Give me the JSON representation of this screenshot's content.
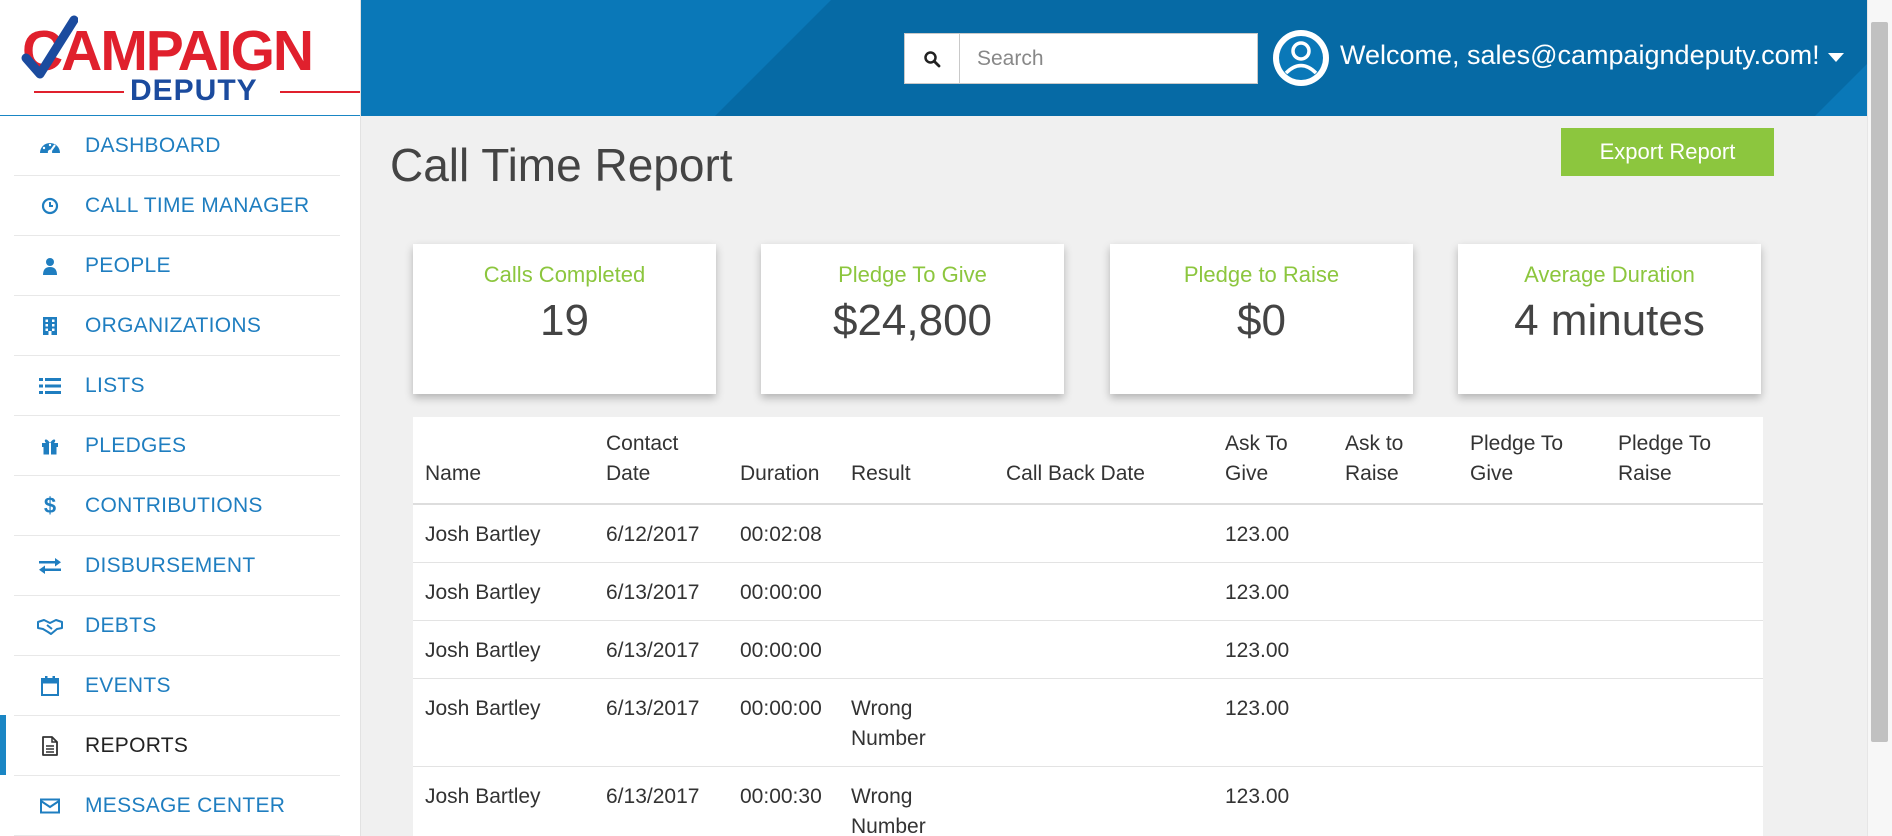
{
  "brand": {
    "logo_top": "CAMPAIGN",
    "logo_bottom": "DEPUTY",
    "colors": {
      "red": "#e0202d",
      "navy": "#1b4b9e",
      "header_blue": "#0a78b8",
      "link_blue": "#1f7ec0",
      "accent_green": "#8cc63e"
    }
  },
  "header": {
    "search_placeholder": "Search",
    "search_icon": "search-icon",
    "avatar_icon": "user-circle-icon",
    "welcome": "Welcome, sales@campaigndeputy.com!"
  },
  "sidebar": {
    "items": [
      {
        "label": "DASHBOARD",
        "icon": "dashboard-icon",
        "active": false
      },
      {
        "label": "CALL TIME MANAGER",
        "icon": "clock-icon",
        "active": false
      },
      {
        "label": "PEOPLE",
        "icon": "user-icon",
        "active": false
      },
      {
        "label": "ORGANIZATIONS",
        "icon": "building-icon",
        "active": false
      },
      {
        "label": "LISTS",
        "icon": "list-icon",
        "active": false
      },
      {
        "label": "PLEDGES",
        "icon": "gift-icon",
        "active": false
      },
      {
        "label": "CONTRIBUTIONS",
        "icon": "dollar-icon",
        "active": false
      },
      {
        "label": "DISBURSEMENT",
        "icon": "exchange-icon",
        "active": false
      },
      {
        "label": "DEBTS",
        "icon": "handshake-icon",
        "active": false
      },
      {
        "label": "EVENTS",
        "icon": "calendar-icon",
        "active": false
      },
      {
        "label": "REPORTS",
        "icon": "document-icon",
        "active": true
      },
      {
        "label": "MESSAGE CENTER",
        "icon": "envelope-icon",
        "active": false
      }
    ]
  },
  "main": {
    "title": "Call Time Report",
    "export_label": "Export Report",
    "stats": [
      {
        "label": "Calls Completed",
        "value": "19"
      },
      {
        "label": "Pledge To Give",
        "value": "$24,800"
      },
      {
        "label": "Pledge to Raise",
        "value": "$0"
      },
      {
        "label": "Average Duration",
        "value": "4 minutes"
      }
    ],
    "table": {
      "columns": [
        [
          "Name"
        ],
        [
          "Contact",
          "Date"
        ],
        [
          "Duration"
        ],
        [
          "Result"
        ],
        [
          "Call Back Date"
        ],
        [
          "Ask To",
          "Give"
        ],
        [
          "Ask to",
          "Raise"
        ],
        [
          "Pledge To",
          "Give"
        ],
        [
          "Pledge To",
          "Raise"
        ]
      ],
      "rows": [
        {
          "name": "Josh Bartley",
          "contact_date": "6/12/2017",
          "duration": "00:02:08",
          "result": [],
          "call_back_date": "",
          "ask_to_give": "123.00",
          "ask_to_raise": "",
          "pledge_to_give": "",
          "pledge_to_raise": ""
        },
        {
          "name": "Josh Bartley",
          "contact_date": "6/13/2017",
          "duration": "00:00:00",
          "result": [],
          "call_back_date": "",
          "ask_to_give": "123.00",
          "ask_to_raise": "",
          "pledge_to_give": "",
          "pledge_to_raise": ""
        },
        {
          "name": "Josh Bartley",
          "contact_date": "6/13/2017",
          "duration": "00:00:00",
          "result": [],
          "call_back_date": "",
          "ask_to_give": "123.00",
          "ask_to_raise": "",
          "pledge_to_give": "",
          "pledge_to_raise": ""
        },
        {
          "name": "Josh Bartley",
          "contact_date": "6/13/2017",
          "duration": "00:00:00",
          "result": [
            "Wrong",
            "Number"
          ],
          "call_back_date": "",
          "ask_to_give": "123.00",
          "ask_to_raise": "",
          "pledge_to_give": "",
          "pledge_to_raise": ""
        },
        {
          "name": "Josh Bartley",
          "contact_date": "6/13/2017",
          "duration": "00:00:30",
          "result": [
            "Wrong",
            "Number"
          ],
          "call_back_date": "",
          "ask_to_give": "123.00",
          "ask_to_raise": "",
          "pledge_to_give": "",
          "pledge_to_raise": ""
        }
      ]
    }
  }
}
